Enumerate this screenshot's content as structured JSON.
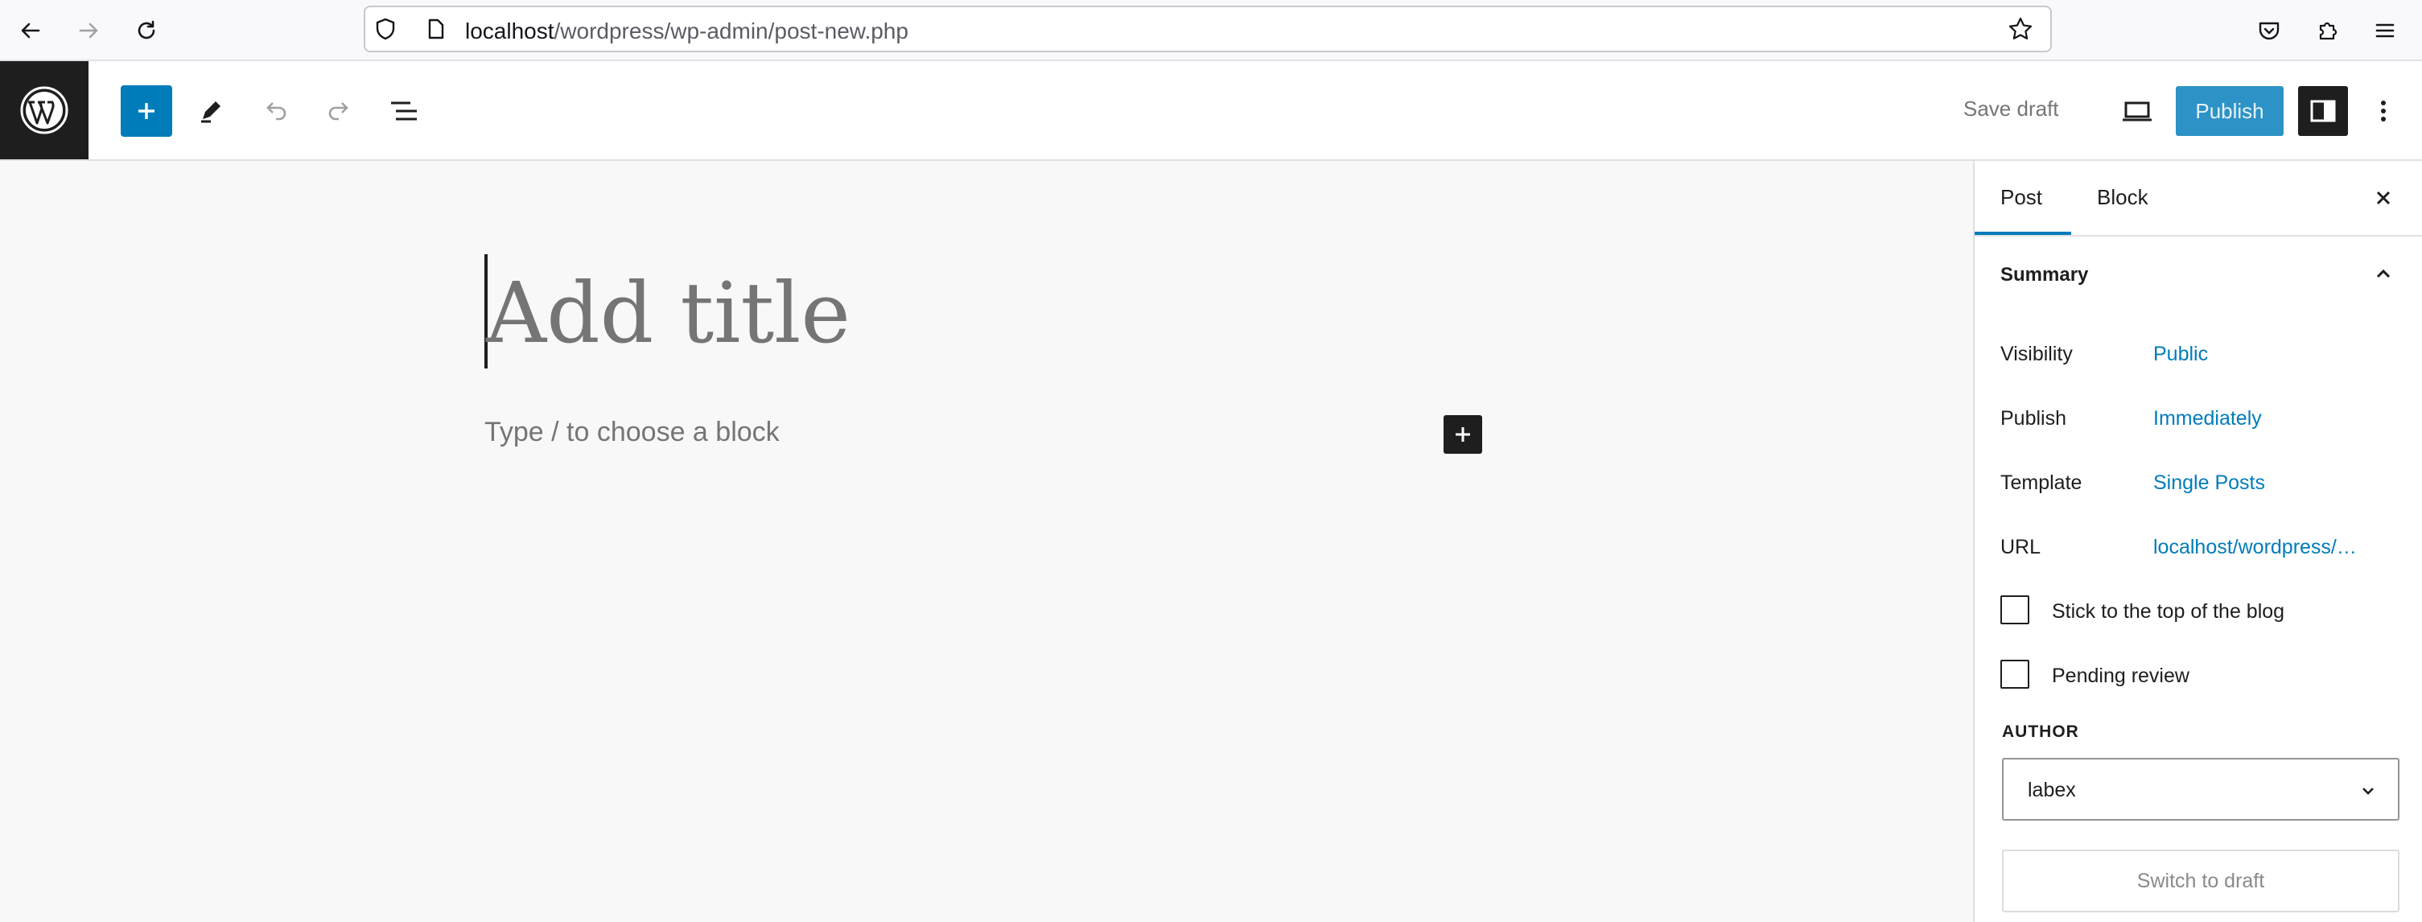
{
  "browser": {
    "url_host": "localhost",
    "url_path": "/wordpress/wp-admin/post-new.php"
  },
  "toolbar": {
    "save_draft_label": "Save draft",
    "publish_label": "Publish"
  },
  "editor": {
    "title_placeholder": "Add title",
    "block_placeholder": "Type / to choose a block"
  },
  "sidebar": {
    "tabs": [
      {
        "label": "Post"
      },
      {
        "label": "Block"
      }
    ],
    "summary_title": "Summary",
    "rows": [
      {
        "label": "Visibility",
        "value": "Public"
      },
      {
        "label": "Publish",
        "value": "Immediately"
      },
      {
        "label": "Template",
        "value": "Single Posts"
      },
      {
        "label": "URL",
        "value": "localhost/wordpress/…"
      }
    ],
    "checkboxes": [
      {
        "label": "Stick to the top of the blog"
      },
      {
        "label": "Pending review"
      }
    ],
    "author_heading": "AUTHOR",
    "author_value": "labex",
    "switch_to_draft_label": "Switch to draft"
  },
  "colors": {
    "accent": "#007cba",
    "dark": "#1e1e1e"
  },
  "icons": [
    "back-icon",
    "forward-icon",
    "reload-icon",
    "shield-icon",
    "page-icon",
    "star-icon",
    "pocket-icon",
    "extensions-icon",
    "menu-icon",
    "wordpress-logo-icon",
    "plus-icon",
    "pencil-icon",
    "undo-icon",
    "redo-icon",
    "list-view-icon",
    "desktop-preview-icon",
    "sidebar-toggle-icon",
    "more-vertical-icon",
    "close-icon",
    "chevron-up-icon",
    "chevron-down-icon"
  ]
}
